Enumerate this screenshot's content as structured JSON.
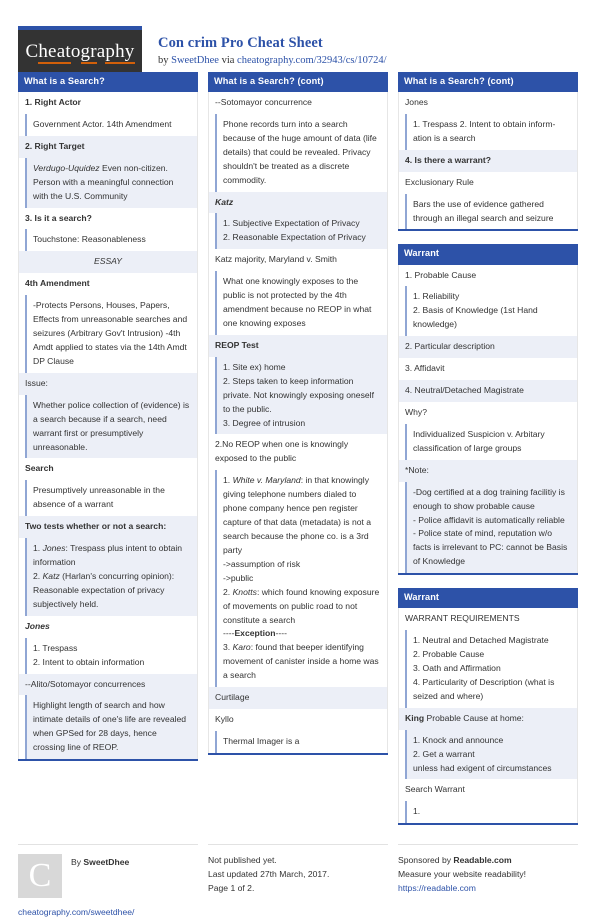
{
  "brand": {
    "logo_text_parts": [
      "C",
      "heat",
      "o",
      "gr",
      "a",
      "phy"
    ],
    "logo_name": "Cheatography"
  },
  "header": {
    "title": "Con crim Pro Cheat Sheet",
    "by_label": "by",
    "author": "SweetDhee",
    "via_label": "via",
    "source_url": "cheatography.com/32943/cs/10724/"
  },
  "columns": [
    {
      "blocks": [
        {
          "title": "What is a Search?",
          "rows": [
            {
              "text": "1. Right Actor",
              "style": "plain head"
            },
            {
              "text": "Government Actor. 14th Amendment",
              "style": "plain indent"
            },
            {
              "text": "2. Right Target",
              "style": "shade head"
            },
            {
              "html": "<i>Verdugo-Uquidez</i> Even non-citizen. Person with a meaningful connection with the U.S. Community",
              "style": "shade indent"
            },
            {
              "text": "3. Is it a search?",
              "style": "plain head"
            },
            {
              "text": "Touchstone: Reasonableness",
              "style": "plain indent"
            },
            {
              "text": "ESSAY",
              "style": "shade center"
            },
            {
              "text": "4th Amendment",
              "style": "plain head"
            },
            {
              "text": "-Protects Persons, Houses, Papers, Effects from unreasonable searches and seizures (Arbitrary Gov't Intrusion) -4th Amdt applied to states via the 14th Amdt DP Clause",
              "style": "plain indent"
            },
            {
              "text": "Issue:",
              "style": "shade"
            },
            {
              "text": "Whether police collection of (evidence) is a search because if a search, need warrant first or presumptively unreasonable.",
              "style": "shade indent"
            },
            {
              "text": "Search",
              "style": "plain head"
            },
            {
              "text": "Presumptively unreasonable in the absence of a warrant",
              "style": "plain indent"
            },
            {
              "text": "Two tests whether or not a search:",
              "style": "shade head"
            },
            {
              "html": "1. <i>Jones</i>: Trespass plus intent to obtain information<br>2. <i>Katz</i> (Harlan's concurring opinion): Reasonable expectation of privacy subjectively held.",
              "style": "shade indent"
            },
            {
              "html": "<i>Jones</i>",
              "style": "plain head"
            },
            {
              "text": "1. Trespass\n2. Intent to obtain information",
              "style": "plain indent"
            },
            {
              "text": "--Alito/Sotomayor concurrences",
              "style": "shade"
            },
            {
              "text": "Highlight length of search and how intimate details of one's life are revealed when GPSed for 28 days, hence crossing line of REOP.",
              "style": "shade indent"
            }
          ]
        }
      ]
    },
    {
      "blocks": [
        {
          "title": "What is a Search? (cont)",
          "rows": [
            {
              "text": "--Sotomayor concurrence",
              "style": "plain"
            },
            {
              "text": "Phone records turn into a search because of the huge amount of data (life details) that could be revealed. Privacy shouldn't be treated as a discrete commodity.",
              "style": "plain indent"
            },
            {
              "html": "<i>Katz</i>",
              "style": "shade head"
            },
            {
              "text": "1. Subjective Expectation of Privacy\n2. Reasonable Expectation of Privacy",
              "style": "shade indent"
            },
            {
              "text": "Katz majority, Maryland v. Smith",
              "style": "plain"
            },
            {
              "text": "What one knowingly exposes to the public is not protected by the 4th amendment because no REOP in what one knowing exposes",
              "style": "plain indent"
            },
            {
              "text": "REOP Test",
              "style": "shade head"
            },
            {
              "text": "1. Site ex) home\n2. Steps taken to keep information private. Not knowingly exposing oneself to the public.\n3. Degree of intrusion",
              "style": "shade indent"
            },
            {
              "text": "2.No REOP when one is knowingly exposed to the public",
              "style": "plain"
            },
            {
              "html": "1. <i>White v. Maryland</i>: in that knowingly giving telephone numbers dialed to phone company hence pen register capture of that data (metadata) is not a search because the phone co. is a 3rd party<br>-&gt;assumption of risk<br>-&gt;public<br>2. <i>Knotts</i>: which found knowing exposure of movements on public road to not constitute a search<br>----<b>Exception</b>----<br>3. <i>Karo</i>: found that beeper identifying movement of canister inside a home was a search",
              "style": "plain indent"
            },
            {
              "text": "Curtilage",
              "style": "shade"
            },
            {
              "text": "Kyllo",
              "style": "plain"
            },
            {
              "text": "Thermal Imager is a",
              "style": "plain indent"
            }
          ]
        }
      ]
    },
    {
      "blocks": [
        {
          "title": "What is a Search? (cont)",
          "rows": [
            {
              "text": "Jones",
              "style": "plain"
            },
            {
              "text": "1. Trespass 2. Intent to obtain inform-ation is a search",
              "style": "plain indent"
            },
            {
              "text": "4. Is there a warrant?",
              "style": "shade head"
            },
            {
              "text": "Exclusionary Rule",
              "style": "plain"
            },
            {
              "text": "Bars the use of evidence gathered through an illegal search and seizure",
              "style": "plain indent"
            }
          ]
        },
        {
          "title": "Warrant",
          "rows": [
            {
              "text": "1. Probable Cause",
              "style": "plain"
            },
            {
              "text": "1. Reliability\n2. Basis of Knowledge (1st Hand knowledge)",
              "style": "plain indent"
            },
            {
              "text": "2. Particular description",
              "style": "shade"
            },
            {
              "text": "3. Affidavit",
              "style": "plain"
            },
            {
              "text": "4. Neutral/Detached Magistrate",
              "style": "shade"
            },
            {
              "text": "Why?",
              "style": "plain"
            },
            {
              "text": "Individualized Suspicion v. Arbitary classification of large groups",
              "style": "plain indent"
            },
            {
              "text": "*Note:",
              "style": "shade"
            },
            {
              "text": "-Dog certified at a dog training facilitiy is enough to show probable cause\n- Police affidavit is automatically reliable\n- Police state of mind, reputation w/o facts is irrelevant to PC: cannot be Basis of Knowledge",
              "style": "shade indent2"
            }
          ]
        },
        {
          "title": "Warrant",
          "rows": [
            {
              "text": "WARRANT REQUIREMENTS",
              "style": "plain"
            },
            {
              "text": "1. Neutral and Detached Magistrate\n2. Probable Cause\n3. Oath and Affirmation\n4. Particularity of Description (what is seized and where)",
              "style": "plain indent"
            },
            {
              "html": "<b>King</b> Probable Cause at home:",
              "style": "shade"
            },
            {
              "text": "1. Knock and announce\n2. Get a warrant\nunless had exigent of circumstances",
              "style": "shade indent"
            },
            {
              "text": "Search Warrant",
              "style": "plain"
            },
            {
              "text": "1.",
              "style": "plain indent"
            }
          ]
        }
      ]
    }
  ],
  "footer": {
    "avatar_letter": "C",
    "by_label": "By",
    "author": "SweetDhee",
    "author_url": "cheatography.com/sweetdhee/",
    "publish_status": "Not published yet.",
    "last_updated": "Last updated 27th March, 2017.",
    "page_number": "Page 1 of 2.",
    "sponsor_label": "Sponsored by",
    "sponsor_name": "Readable.com",
    "sponsor_tagline": "Measure your website readability!",
    "sponsor_url": "https://readable.com"
  }
}
